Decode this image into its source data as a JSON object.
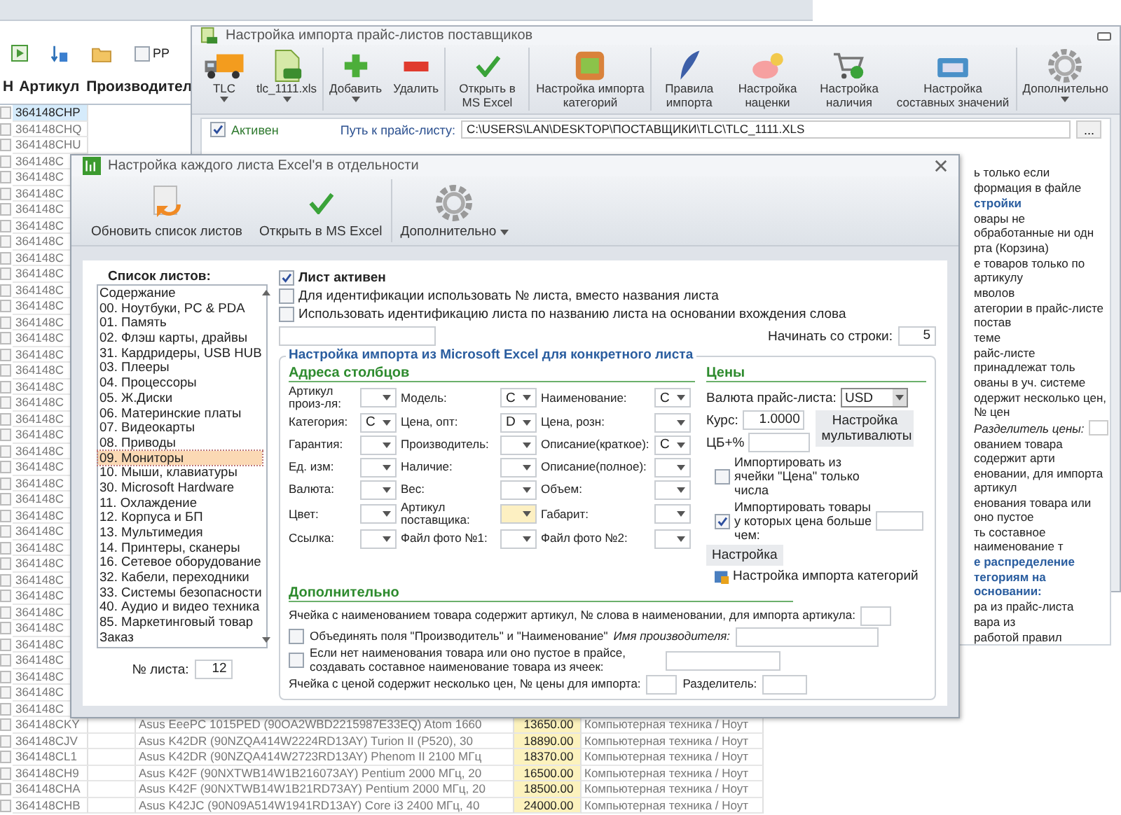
{
  "main_app": {
    "toolbar": {
      "checkbox": {
        "label": "PP",
        "checked": false
      }
    },
    "columns": [
      "Н",
      "Артикул",
      "Производител"
    ],
    "rows": [
      {
        "code": "364148CHP",
        "selected": true,
        "checked": false
      },
      {
        "code": "364148CHQ",
        "selected": false,
        "checked": false
      },
      {
        "code": "364148CHU",
        "selected": false,
        "checked": false
      },
      {
        "code": "364148C",
        "selected": false,
        "checked": false
      },
      {
        "code": "364148C",
        "selected": false,
        "checked": false
      },
      {
        "code": "364148C",
        "selected": false,
        "checked": false
      },
      {
        "code": "364148C",
        "selected": false,
        "checked": false
      },
      {
        "code": "364148C",
        "selected": false,
        "checked": false
      },
      {
        "code": "364148C",
        "selected": false,
        "checked": false
      },
      {
        "code": "364148C",
        "selected": false,
        "checked": false
      },
      {
        "code": "364148C",
        "selected": false,
        "checked": false
      },
      {
        "code": "364148C",
        "selected": false,
        "checked": false
      },
      {
        "code": "364148C",
        "selected": false,
        "checked": false
      },
      {
        "code": "364148C",
        "selected": false,
        "checked": false
      },
      {
        "code": "364148C",
        "selected": false,
        "checked": false
      },
      {
        "code": "364148C",
        "selected": false,
        "checked": false
      },
      {
        "code": "364148C",
        "selected": false,
        "checked": false
      },
      {
        "code": "364148C",
        "selected": false,
        "checked": false
      },
      {
        "code": "364148C",
        "selected": false,
        "checked": false
      },
      {
        "code": "364148C",
        "selected": false,
        "checked": false
      },
      {
        "code": "364148C",
        "selected": false,
        "checked": false
      },
      {
        "code": "364148C",
        "selected": false,
        "checked": false
      },
      {
        "code": "364148C",
        "selected": false,
        "checked": false
      },
      {
        "code": "364148C",
        "selected": false,
        "checked": false
      },
      {
        "code": "364148C",
        "selected": false,
        "checked": false
      },
      {
        "code": "364148C",
        "selected": false,
        "checked": false
      },
      {
        "code": "364148C",
        "selected": false,
        "checked": false
      },
      {
        "code": "364148C",
        "selected": false,
        "checked": false
      },
      {
        "code": "364148C",
        "selected": false,
        "checked": false
      },
      {
        "code": "364148C",
        "selected": false,
        "checked": false
      },
      {
        "code": "364148C",
        "selected": false,
        "checked": false
      },
      {
        "code": "364148C",
        "selected": false,
        "checked": false
      },
      {
        "code": "364148C",
        "selected": false,
        "checked": false
      },
      {
        "code": "364148C",
        "selected": false,
        "checked": false
      },
      {
        "code": "364148C",
        "selected": false,
        "checked": false
      },
      {
        "code": "364148C",
        "selected": false,
        "checked": false
      },
      {
        "code": "364148C",
        "selected": false,
        "checked": false
      },
      {
        "code": "364148C",
        "selected": false,
        "checked": false
      },
      {
        "code": "364148CKY",
        "selected": false,
        "checked": false,
        "name": "Asus EeePC 1015PED (90OA2WBD2215987E33EQ) Atom 1660",
        "price": "13650.00",
        "category": "Компьютерная техника / Ноут"
      },
      {
        "code": "364148CJV",
        "selected": false,
        "checked": false,
        "name": "Asus K42DR (90NZQA414W2224RD13AY) Turion II (P520), 30",
        "price": "18890.00",
        "category": "Компьютерная техника / Ноут"
      },
      {
        "code": "364148CL1",
        "selected": false,
        "checked": false,
        "name": "Asus K42DR (90NZQA414W2723RD13AY) Phenom II 2100 МГц",
        "price": "18370.00",
        "category": "Компьютерная техника / Ноут"
      },
      {
        "code": "364148CH9",
        "selected": false,
        "checked": false,
        "name": "Asus K42F (90NXTWB14W1B216073AY) Pentium 2000 МГц, 20",
        "price": "16500.00",
        "category": "Компьютерная техника / Ноут"
      },
      {
        "code": "364148CHA",
        "selected": false,
        "checked": false,
        "name": "Asus K42F (90NXTWB14W1B21RD73AY) Pentium 2000 МГц, 20",
        "price": "18500.00",
        "category": "Компьютерная техника / Ноут"
      },
      {
        "code": "364148CHB",
        "selected": false,
        "checked": false,
        "name": "Asus K42JC (90N09A514W1941RD13AY) Core i3 2400 МГц, 40",
        "price": "24000.00",
        "category": "Компьютерная техника / Ноут"
      }
    ]
  },
  "import_window": {
    "title": "Настройка импорта прайс-листов поставщиков",
    "toolbar": [
      {
        "label": "TLC",
        "dropdown": true
      },
      {
        "label": "tlc_1111.xls",
        "dropdown": true
      },
      {
        "label": "Добавить",
        "dropdown": true
      },
      {
        "label": "Удалить",
        "dropdown": false
      },
      {
        "label": "Открыть в MS Excel",
        "dropdown": false
      },
      {
        "label": "Настройка импорта категорий",
        "dropdown": false
      },
      {
        "label": "Правила импорта",
        "dropdown": false
      },
      {
        "label": "Настройка наценки",
        "dropdown": false
      },
      {
        "label": "Настройка наличия",
        "dropdown": false
      },
      {
        "label": "Настройка составных значений",
        "dropdown": false
      },
      {
        "label": "Дополнительно",
        "dropdown": true
      }
    ],
    "active_checkbox": {
      "label": "Активен",
      "checked": true
    },
    "path": {
      "label": "Путь к прайс-листу:",
      "value": "C:\\USERS\\LAN\\DESKTOP\\ПОСТАВЩИКИ\\TLC\\TLC_1111.XLS"
    },
    "browse_button": "...",
    "fragments": [
      {
        "kind": "text",
        "text": "ь только если"
      },
      {
        "kind": "text",
        "text": "формация в файле"
      },
      {
        "kind": "heading",
        "text": "стройки"
      },
      {
        "kind": "text",
        "text": "овары не обработанные ни одн"
      },
      {
        "kind": "text",
        "text": "рта (Корзина)"
      },
      {
        "kind": "text",
        "text": "е товаров только по артикулу"
      },
      {
        "kind": "text",
        "text": "мволов"
      },
      {
        "kind": "text",
        "text": "атегории в прайс-листе постав"
      },
      {
        "kind": "text",
        "text": "теме"
      },
      {
        "kind": "text",
        "text": "райс-листе принадлежат толь"
      },
      {
        "kind": "text",
        "text": "ованы в уч. системе"
      },
      {
        "kind": "text",
        "text": "одержит несколько цен, № цен"
      },
      {
        "kind": "field",
        "text": "Разделитель цены:"
      },
      {
        "kind": "text",
        "text": "ованием товара содержит арти"
      },
      {
        "kind": "text",
        "text": "еновании, для импорта артикул"
      },
      {
        "kind": "text",
        "text": "енования товара или оно пустое"
      },
      {
        "kind": "text",
        "text": "ть составное наименование т"
      },
      {
        "kind": "heading",
        "text": "е распределение"
      },
      {
        "kind": "heading",
        "text": "тегориям на основании:"
      },
      {
        "kind": "text",
        "text": "ра из прайс-листа"
      },
      {
        "kind": "text",
        "text": "вара из"
      },
      {
        "kind": "text",
        "text": "работой правил"
      }
    ]
  },
  "sheet_dialog": {
    "title": "Настройка каждого листа Excel'я в отдельности",
    "toolbar": [
      {
        "label": "Обновить список листов",
        "dropdown": false
      },
      {
        "label": "Открыть в MS Excel",
        "dropdown": false
      },
      {
        "label": "Дополнительно",
        "dropdown": true
      }
    ],
    "sheets_label": "Список листов:",
    "sheets": [
      {
        "label": "Содержание",
        "selected": false
      },
      {
        "label": "00. Ноутбуки, PC & PDA",
        "selected": false
      },
      {
        "label": "01. Память",
        "selected": false
      },
      {
        "label": "02. Флэш карты, драйвы",
        "selected": false
      },
      {
        "label": "31. Кардридеры, USB HUB",
        "selected": false
      },
      {
        "label": "03. Плееры",
        "selected": false
      },
      {
        "label": "04. Процессоры",
        "selected": false
      },
      {
        "label": "05. Ж.Диски",
        "selected": false
      },
      {
        "label": "06. Материнские платы",
        "selected": false
      },
      {
        "label": "07. Видеокарты",
        "selected": false
      },
      {
        "label": "08. Приводы",
        "selected": false
      },
      {
        "label": "09. Мониторы",
        "selected": true
      },
      {
        "label": "10. Мыши, клавиатуры",
        "selected": false
      },
      {
        "label": "30. Microsoft Hardware",
        "selected": false
      },
      {
        "label": "11. Охлаждение",
        "selected": false
      },
      {
        "label": "12. Корпуса и БП",
        "selected": false
      },
      {
        "label": "13. Мультимедия",
        "selected": false
      },
      {
        "label": "14. Принтеры, сканеры",
        "selected": false
      },
      {
        "label": "16. Сетевое оборудование",
        "selected": false
      },
      {
        "label": "32. Кабели, переходники",
        "selected": false
      },
      {
        "label": "33. Системы безопасности",
        "selected": false
      },
      {
        "label": "40. Аудио и видео техника",
        "selected": false
      },
      {
        "label": "85. Маркетинговый товар",
        "selected": false
      },
      {
        "label": "Заказ",
        "selected": false
      }
    ],
    "sheet_number": {
      "label": "№ листа:",
      "value": "12"
    },
    "options": [
      {
        "label": "Лист активен",
        "checked": true,
        "bold": true
      },
      {
        "label": "Для идентификации использовать № листа, вместо названия листа",
        "checked": false,
        "bold": false
      },
      {
        "label": "Использовать идентификацию листа по названию листа на основании вхождения слова",
        "checked": false,
        "bold": false
      }
    ],
    "start_row": {
      "label": "Начинать со строки:",
      "value": "5"
    },
    "group_title": "Настройка импорта из Microsoft Excel для конкретного листа",
    "columns_title": "Адреса столбцов",
    "column_fields": [
      {
        "label": "Артикул произ-ля:",
        "focused": false
      },
      {
        "label": "Модель:",
        "value": "C",
        "focused": false
      },
      {
        "label": "Наименование:",
        "value": "C",
        "focused": false
      },
      {
        "label": "Категория:",
        "value": "C",
        "focused": false
      },
      {
        "label": "Цена, опт:",
        "value": "D",
        "focused": false
      },
      {
        "label": "Цена, розн:",
        "focused": false
      },
      {
        "label": "Гарантия:",
        "focused": false
      },
      {
        "label": "Производитель:",
        "focused": false
      },
      {
        "label": "Описание(краткое):",
        "value": "C",
        "focused": false
      },
      {
        "label": "Ед. изм:",
        "focused": false
      },
      {
        "label": "Наличие:",
        "focused": false
      },
      {
        "label": "Описание(полное):",
        "focused": false
      },
      {
        "label": "Валюта:",
        "focused": false
      },
      {
        "label": "Вес:",
        "focused": false
      },
      {
        "label": "Объем:",
        "focused": false
      },
      {
        "label": "Цвет:",
        "focused": false
      },
      {
        "label": "Артикул поставщика:",
        "focused": true
      },
      {
        "label": "Габарит:",
        "focused": false
      },
      {
        "label": "Ссылка:",
        "focused": false
      },
      {
        "label": "Файл фото №1:",
        "focused": false
      },
      {
        "label": "Файл фото №2:",
        "focused": false
      }
    ],
    "prices_title": "Цены",
    "currency": {
      "label": "Валюта прайс-листа:",
      "value": "USD"
    },
    "rate": {
      "label": "Курс:",
      "value": "1.0000"
    },
    "multicurrency_button": "Настройка мультивалюты",
    "cb_percent": {
      "label": "ЦБ+%"
    },
    "price_options": [
      {
        "label": "Импортировать из ячейки \"Цена\" только числа",
        "checked": false,
        "has_field": false
      },
      {
        "label": "Импортировать товары у которых цена больше чем:",
        "checked": true,
        "has_field": true
      }
    ],
    "settings_button": "Настройка",
    "categories_link": "Настройка импорта категорий",
    "extra_title": "Дополнительно",
    "article_word": {
      "label": "Ячейка с наименованием товара содержит артикул, № слова в наименовании, для импорта артикула:"
    },
    "merge_fields": {
      "label": "Объединять поля \"Производитель\" и \"Наименование\"",
      "checked": false,
      "field_label": "Имя производителя:"
    },
    "compose_name": {
      "label": "Если нет наименования товара или оно пустое в прайсе, создавать составное наименование товара из ячеек:",
      "checked": false
    },
    "multi_price": {
      "label": "Ячейка с ценой содержит несколько цен, № цены для импорта:",
      "separator_label": "Разделитель:"
    }
  }
}
